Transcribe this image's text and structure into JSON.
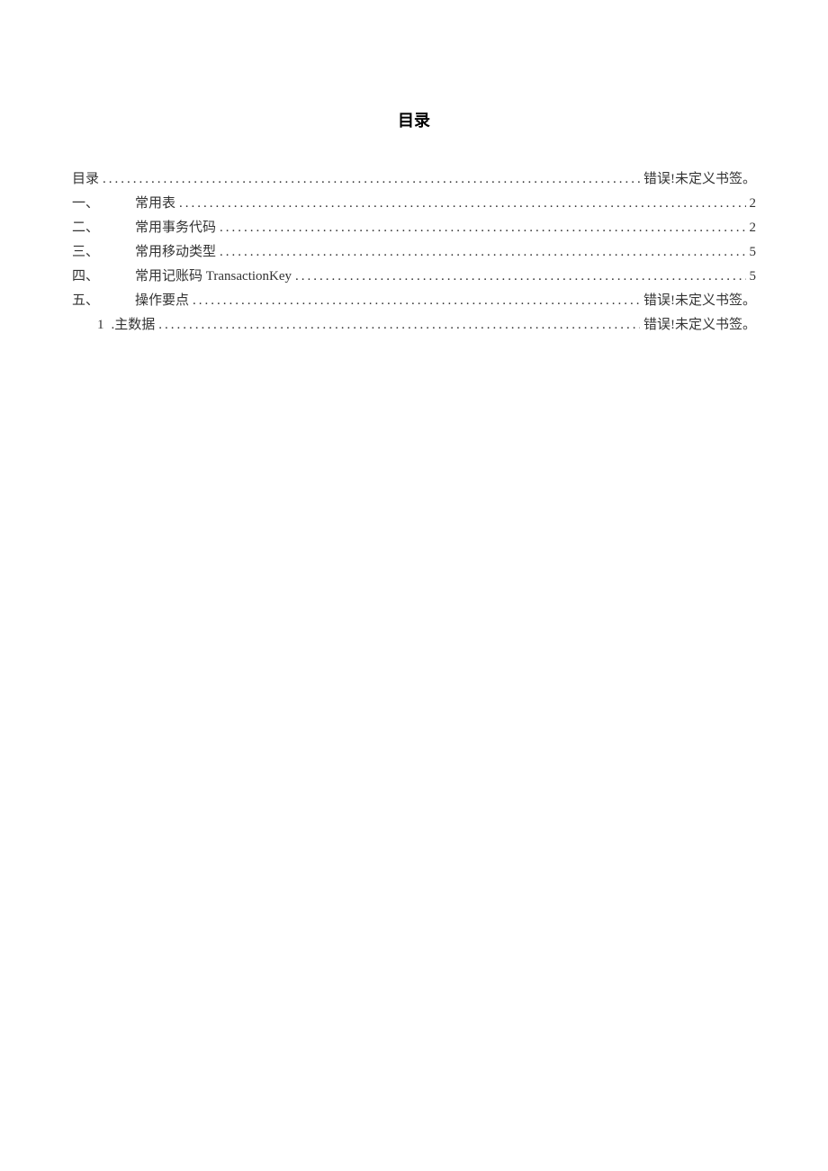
{
  "title": "目录",
  "entries": [
    {
      "number": "",
      "label": "目录",
      "page": "错误!未定义书签。",
      "indent": "indent-0",
      "numClass": ""
    },
    {
      "number": "一、",
      "label": "常用表",
      "page": "2",
      "indent": "indent-1",
      "numClass": "num-wide"
    },
    {
      "number": "二、",
      "label": "常用事务代码",
      "page": "2",
      "indent": "indent-1",
      "numClass": "num-wide"
    },
    {
      "number": "三、",
      "label": "常用移动类型",
      "page": "5",
      "indent": "indent-1",
      "numClass": "num-wide"
    },
    {
      "number": "四、",
      "label": "常用记账码 TransactionKey",
      "page": "5",
      "indent": "indent-1",
      "numClass": "num-wide"
    },
    {
      "number": "五、",
      "label": "操作要点",
      "page": "错误!未定义书签。",
      "indent": "indent-1",
      "numClass": "num-wide"
    },
    {
      "number": "1",
      "label": ".主数据",
      "page": "错误!未定义书签。",
      "indent": "indent-2",
      "numClass": ""
    }
  ],
  "dots": ".................................................................................................................................."
}
